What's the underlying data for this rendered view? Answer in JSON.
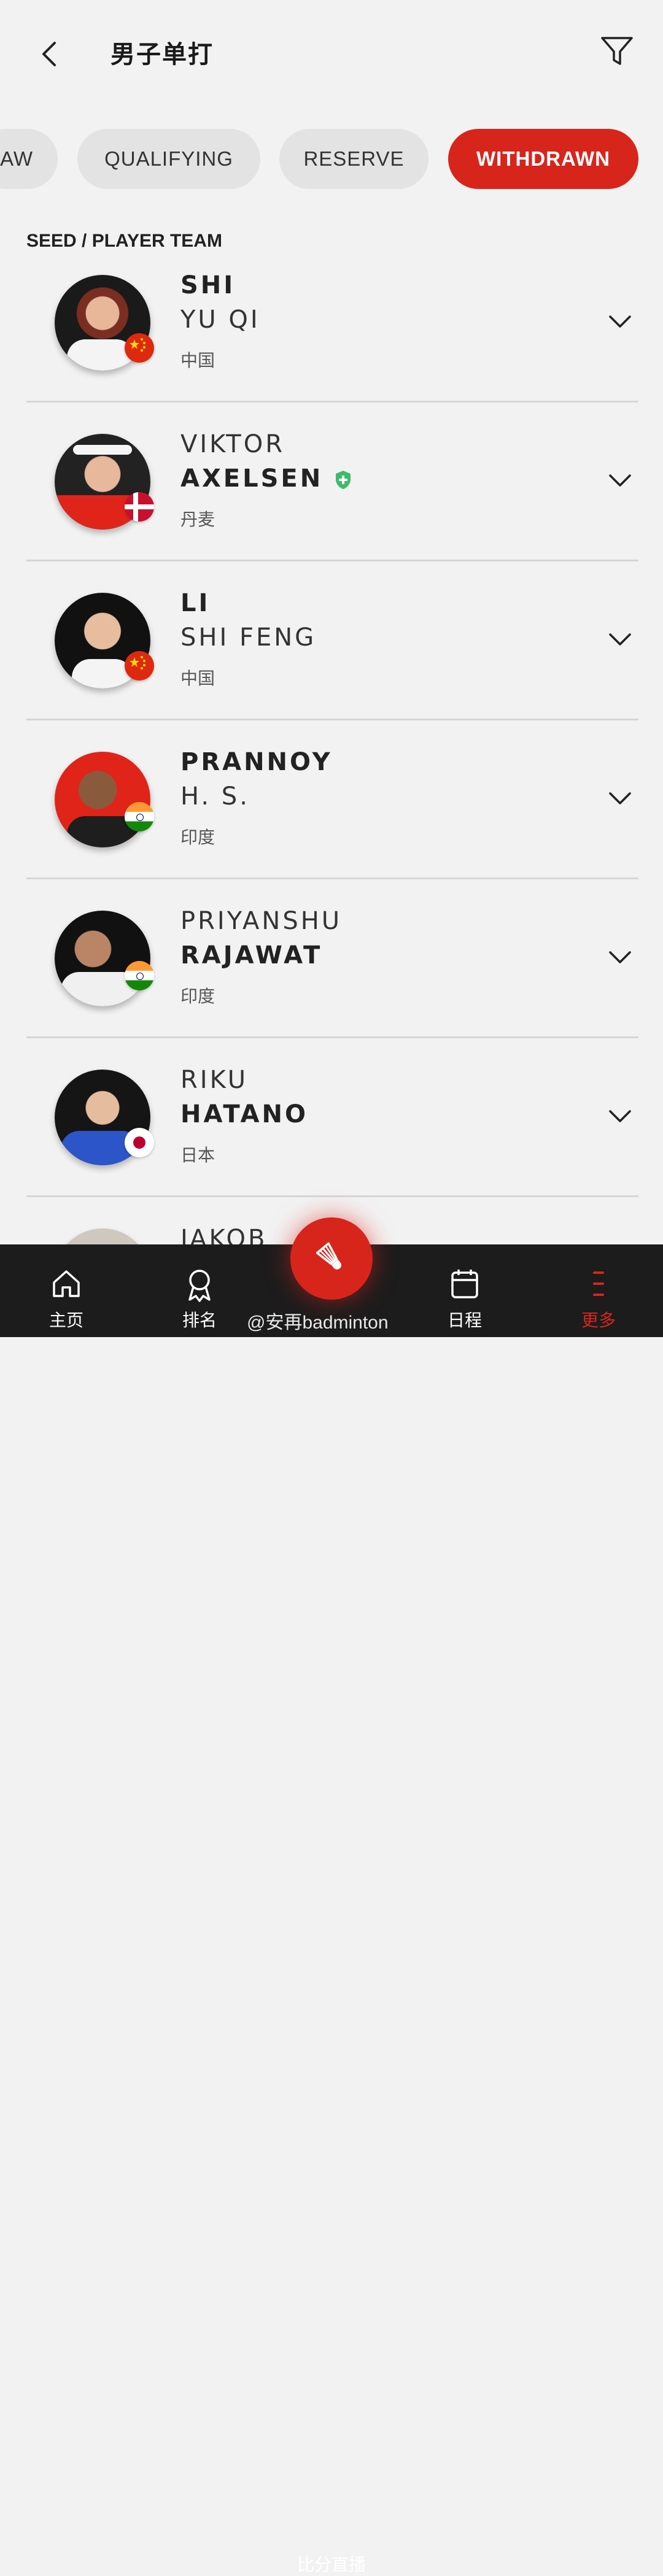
{
  "header": {
    "title": "男子单打"
  },
  "tabs": [
    {
      "label": "AW",
      "active": false
    },
    {
      "label": "QUALIFYING",
      "active": false
    },
    {
      "label": "RESERVE",
      "active": false
    },
    {
      "label": "WITHDRAWN",
      "active": true
    }
  ],
  "list_header": "SEED / PLAYER TEAM",
  "players": [
    {
      "line1": "SHI",
      "line2": "YU QI",
      "bold_line": 1,
      "country": "中国",
      "flag": "china-flag"
    },
    {
      "line1": "VIKTOR",
      "line2": "AXELSEN",
      "bold_line": 2,
      "country": "丹麦",
      "flag": "denmark-flag",
      "badge": "shield-plus-icon"
    },
    {
      "line1": "LI",
      "line2": "SHI FENG",
      "bold_line": 1,
      "country": "中国",
      "flag": "china-flag"
    },
    {
      "line1": "PRANNOY",
      "line2": "H. S.",
      "bold_line": 1,
      "country": "印度",
      "flag": "india-flag"
    },
    {
      "line1": "PRIYANSHU",
      "line2": "RAJAWAT",
      "bold_line": 2,
      "country": "印度",
      "flag": "india-flag"
    },
    {
      "line1": "RIKU",
      "line2": "HATANO",
      "bold_line": 2,
      "country": "日本",
      "flag": "japan-flag"
    },
    {
      "line1": "JAKOB",
      "line2": "",
      "bold_line": 1,
      "country": "",
      "flag": ""
    }
  ],
  "nav": {
    "home": "主页",
    "ranking": "排名",
    "live": "比分直播",
    "schedule": "日程",
    "more": "更多"
  },
  "watermark": "@安再badminton",
  "colors": {
    "accent": "#d8251c",
    "background": "#f2f2f2",
    "nav_bg": "#1c1c1c"
  }
}
